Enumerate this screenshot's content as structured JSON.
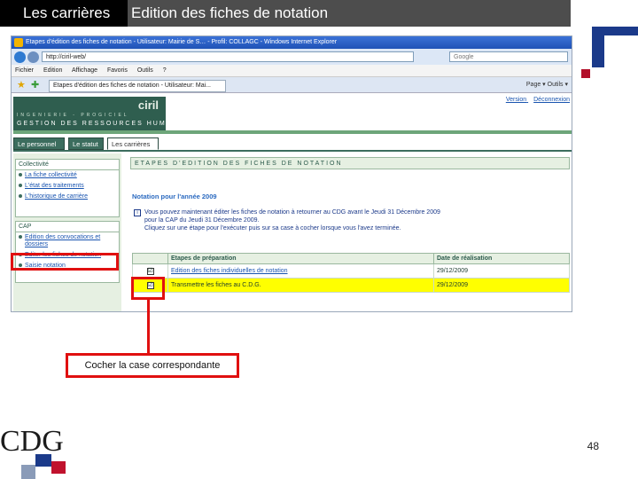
{
  "slide": {
    "section_title": "Les carrières",
    "slide_title": "Edition des fiches de notation",
    "callout": "Cocher la case correspondante",
    "page_number": "48",
    "logo_text": "CDG",
    "colors": {
      "accent_red": "#e01010",
      "header_black": "#000000",
      "header_grey": "#4d4d4d",
      "deco_blue": "#1b3a8a"
    }
  },
  "browser": {
    "window_title": "Etapes d'édition des fiches de notation - Utilisateur: Mairie de S… - Profil: COLLAGC - Windows Internet Explorer",
    "address": "http://ciril-web/",
    "search_placeholder": "Google",
    "menu": [
      "Fichier",
      "Edition",
      "Affichage",
      "Favoris",
      "Outils",
      "?"
    ],
    "tab_label": "Etapes d'édition des fiches de notation - Utilisateur: Mai...",
    "toolbar_right": "Page ▾  Outils ▾"
  },
  "app": {
    "top_links": [
      "Version",
      "Déconnexion"
    ],
    "brand_name": "ciril",
    "brand_tag1": "INGENIERIE - PROGICIEL",
    "brand_tag2": "GESTION DES RESSOURCES HUMAINES",
    "tabs": [
      "Le personnel",
      "Le statut",
      "Les carrières"
    ],
    "sidebar": {
      "collectivite_title": "Collectivité",
      "collectivite_links": [
        "La fiche collectivité",
        "L'état des traitements",
        "L'historique de carrière"
      ],
      "cap_title": "CAP",
      "cap_links": [
        "Edition des convocations et dossiers",
        "Editer les fiches de notation",
        "Saisie notation"
      ]
    },
    "main": {
      "section_header": "ETAPES D'EDITION DES FICHES DE NOTATION",
      "notation_title": "Notation pour l'année 2009",
      "info_lines": [
        "Vous pouvez maintenant éditer les fiches de notation à retourner au CDG avant le Jeudi 31 Décembre 2009",
        "pour la CAP du Jeudi 31 Décembre 2009.",
        "Cliquez sur une étape pour l'exécuter puis sur sa case à cocher lorsque vous l'avez terminée."
      ],
      "table_headers": [
        "",
        "Etapes de préparation",
        "Date de réalisation"
      ],
      "rows": [
        {
          "checked": "☑",
          "step": "Edition des fiches individuelles de notation",
          "date": "29/12/2009"
        },
        {
          "checked": "☑",
          "step": "Transmettre les fiches au C.D.G.",
          "date": "29/12/2009"
        }
      ]
    }
  }
}
